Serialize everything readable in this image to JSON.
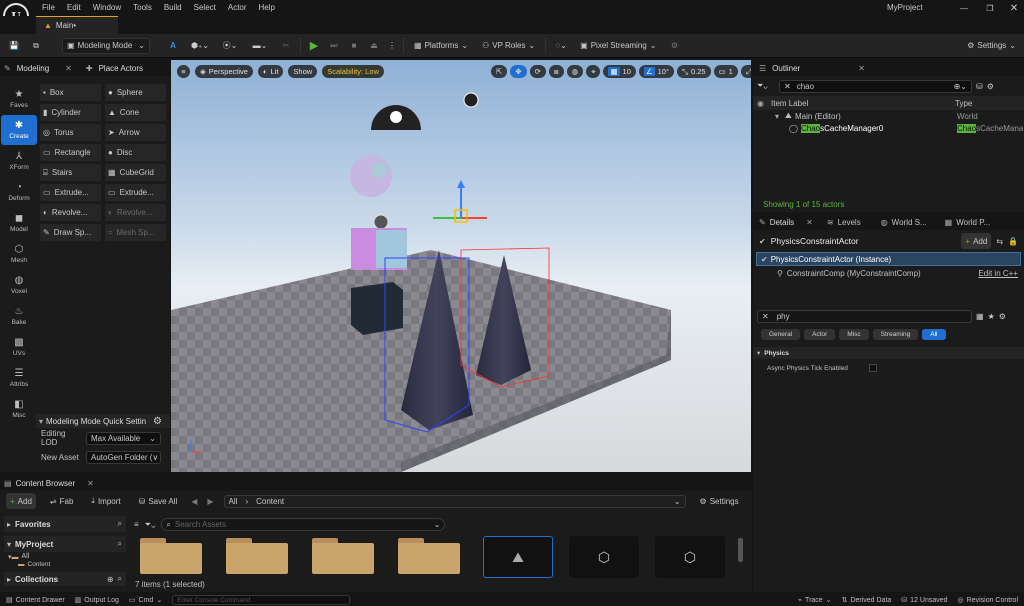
{
  "menu": [
    "File",
    "Edit",
    "Window",
    "Tools",
    "Build",
    "Select",
    "Actor",
    "Help"
  ],
  "project_name": "MyProject",
  "level_tab": "Main•",
  "toolbar": {
    "mode": "Modeling Mode",
    "platforms": "Platforms",
    "vp_roles": "VP Roles",
    "pixel_streaming": "Pixel Streaming",
    "settings": "Settings"
  },
  "left_tabs": {
    "modeling": "Modeling",
    "place_actors": "Place Actors"
  },
  "categories": [
    "Faves",
    "Create",
    "XForm",
    "Deform",
    "Model",
    "Mesh",
    "Voxel",
    "Bake",
    "UVs",
    "Attribs",
    "Misc"
  ],
  "tools": [
    {
      "label": "Box",
      "dim": false
    },
    {
      "label": "Sphere",
      "dim": false
    },
    {
      "label": "Cylinder",
      "dim": false
    },
    {
      "label": "Cone",
      "dim": false
    },
    {
      "label": "Torus",
      "dim": false
    },
    {
      "label": "Arrow",
      "dim": false
    },
    {
      "label": "Rectangle",
      "dim": false
    },
    {
      "label": "Disc",
      "dim": false
    },
    {
      "label": "Stairs",
      "dim": false
    },
    {
      "label": "CubeGrid",
      "dim": false
    },
    {
      "label": "Extrude...",
      "dim": false
    },
    {
      "label": "Extrude...",
      "dim": false
    },
    {
      "label": "Revolve...",
      "dim": false
    },
    {
      "label": "Revolve...",
      "dim": true
    },
    {
      "label": "Draw Sp...",
      "dim": false
    },
    {
      "label": "Mesh Sp...",
      "dim": true
    }
  ],
  "quick_settings": {
    "title": "Modeling Mode Quick Settin",
    "editing_lod_label": "Editing LOD",
    "editing_lod_value": "Max Available",
    "new_asset_label": "New Asset",
    "new_asset_value": "AutoGen Folder (",
    "new_asset_arrow": "∨"
  },
  "viewport": {
    "perspective": "Perspective",
    "lit": "Lit",
    "show": "Show",
    "scalability": "Scalability: Low",
    "grid_snap": "10",
    "rot_snap": "10°",
    "scale_snap": "0.25",
    "cam_speed": "1"
  },
  "outliner": {
    "title": "Outliner",
    "search": "chao",
    "col_label": "Item Label",
    "col_type": "Type",
    "rows": [
      {
        "label": "Main (Editor)",
        "type": "World"
      },
      {
        "label_hl": "Chao",
        "label_rest": "sCacheManager0",
        "type_hl": "Chao",
        "type_rest": "sCacheManag"
      }
    ],
    "count": "Showing 1 of 15 actors"
  },
  "details": {
    "tabs": [
      "Details",
      "Levels",
      "World S...",
      "World P..."
    ],
    "actor": "PhysicsConstraintActor",
    "add": "Add",
    "instance": "PhysicsConstraintActor (Instance)",
    "component": "ConstraintComp (MyConstraintComp)",
    "edit_cpp": "Edit in C++",
    "search": "phy",
    "filters": [
      "General",
      "Actor",
      "Misc",
      "Streaming",
      "All"
    ],
    "section": "Physics",
    "property": "Async Physics Tick Enabled"
  },
  "content_browser": {
    "title": "Content Browser",
    "add": "Add",
    "fab": "Fab",
    "import": "Import",
    "save_all": "Save All",
    "path": [
      "All",
      "Content"
    ],
    "settings": "Settings",
    "favorites": "Favorites",
    "project": "MyProject",
    "tree": [
      "All",
      "Content"
    ],
    "collections": "Collections",
    "search_placeholder": "Search Assets",
    "count": "7 items (1 selected)"
  },
  "status": {
    "drawer": "Content Drawer",
    "output_log": "Output Log",
    "cmd": "Cmd",
    "console_placeholder": "Enter Console Command",
    "trace": "Trace",
    "derived": "Derived Data",
    "unsaved": "12 Unsaved",
    "revision": "Revision Control"
  },
  "colors": {
    "accent": "#1f6fd1",
    "highlight": "#5ab63a",
    "scalability": "#e8c33c"
  }
}
